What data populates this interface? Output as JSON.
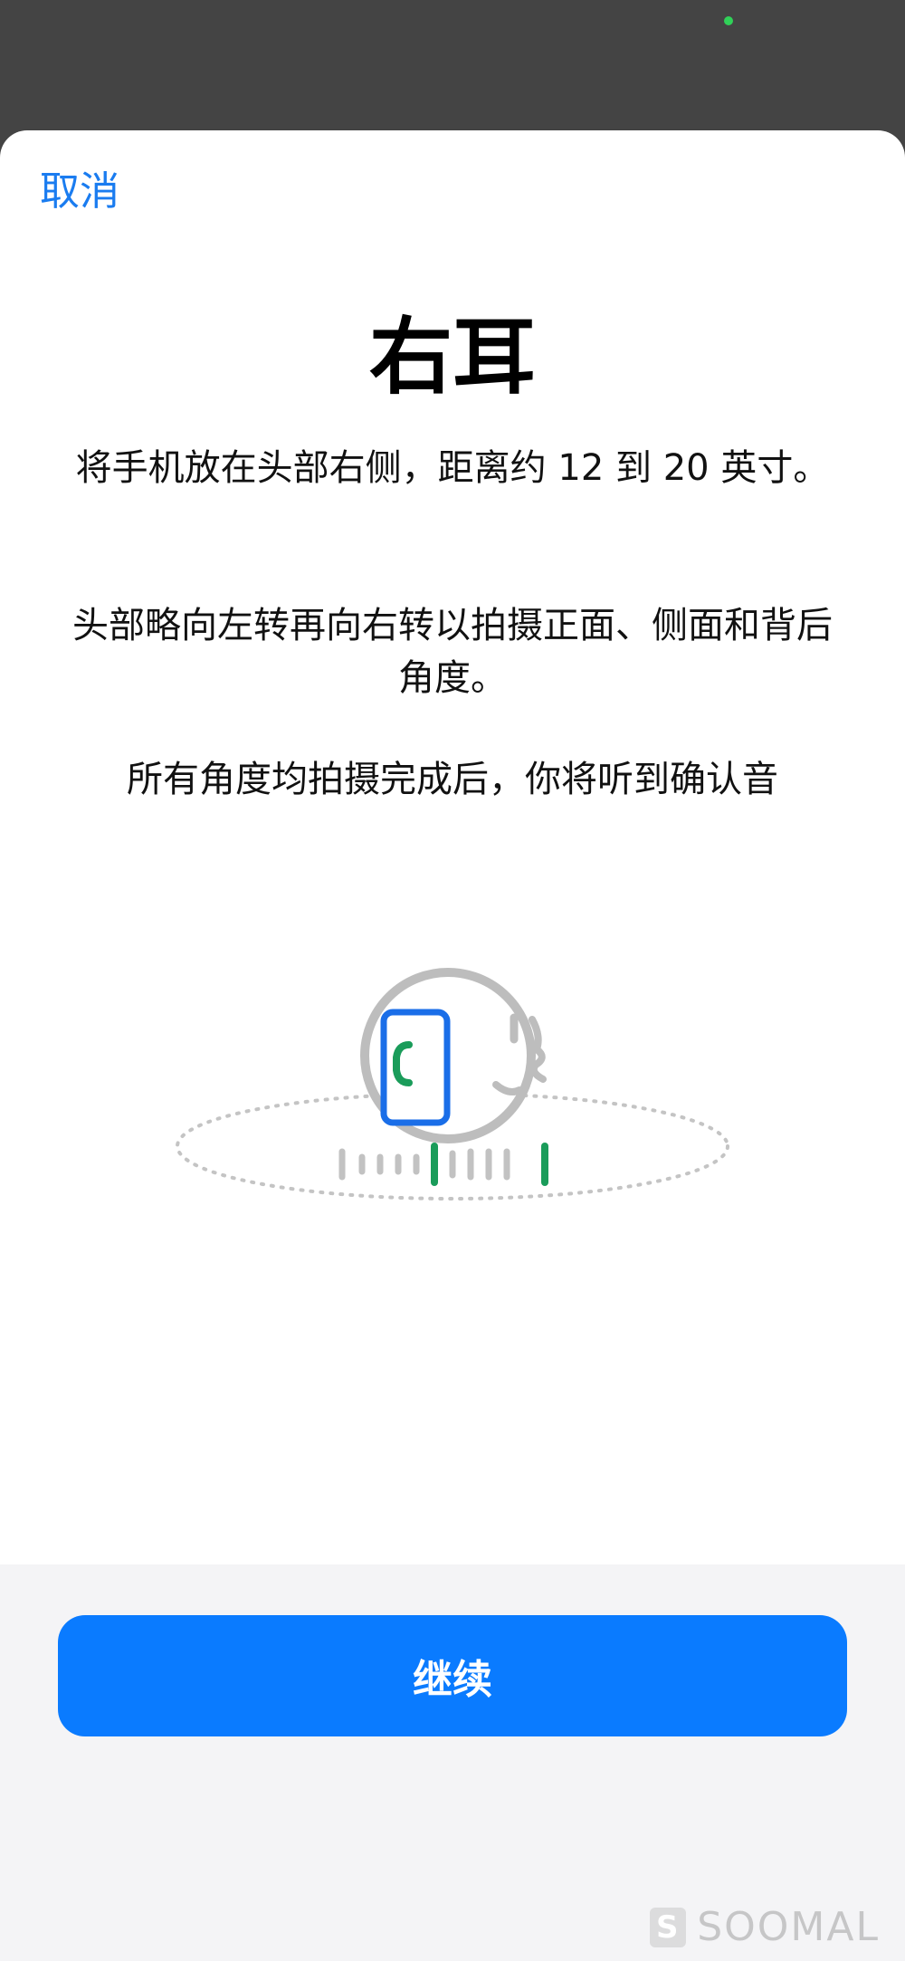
{
  "status_bar": {
    "indicator_color": "#30d158"
  },
  "sheet": {
    "cancel_label": "取消",
    "title": "右耳",
    "paragraphs": [
      "将手机放在头部右侧，距离约 12 到 20 英寸。",
      "头部略向左转再向右转以拍摄正面、侧面和背后角度。",
      "所有角度均拍摄完成后，你将听到确认音"
    ],
    "continue_label": "继续",
    "accent_color": "#0a7bff",
    "capture_color": "#1a9c5a"
  },
  "watermark": {
    "logo_letter": "S",
    "text": "SOOMAL"
  }
}
